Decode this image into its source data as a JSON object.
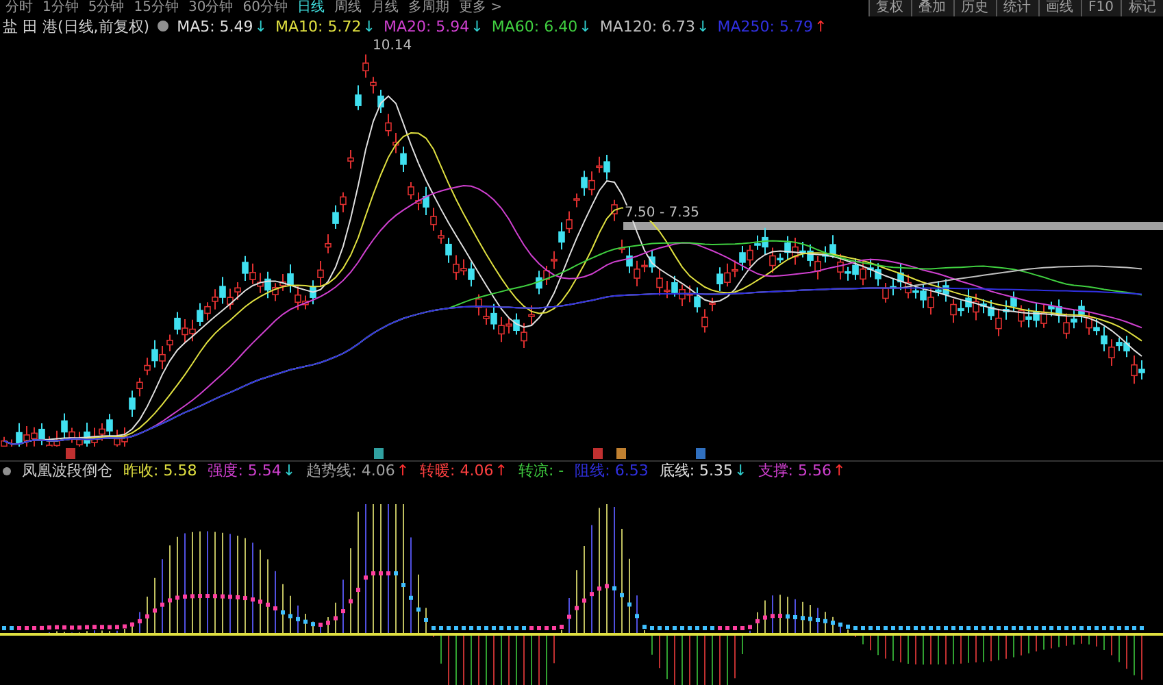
{
  "toolbar": {
    "periods": [
      {
        "label": "分时",
        "selected": false
      },
      {
        "label": "1分钟",
        "selected": false
      },
      {
        "label": "5分钟",
        "selected": false
      },
      {
        "label": "15分钟",
        "selected": false
      },
      {
        "label": "30分钟",
        "selected": false
      },
      {
        "label": "60分钟",
        "selected": false
      },
      {
        "label": "日线",
        "selected": true
      },
      {
        "label": "周线",
        "selected": false
      },
      {
        "label": "月线",
        "selected": false
      },
      {
        "label": "多周期",
        "selected": false
      },
      {
        "label": "更多 >",
        "selected": false
      }
    ],
    "buttons": [
      "复权",
      "叠加",
      "历史",
      "统计",
      "画线",
      "F10",
      "标记"
    ]
  },
  "price_panel": {
    "title": "盐 田 港(日线,前复权)",
    "averages": [
      {
        "label": "MA5: 5.49",
        "arrow": "↓",
        "rising": false,
        "color": "#e0e0e0"
      },
      {
        "label": "MA10: 5.72",
        "arrow": "↓",
        "rising": false,
        "color": "#e0e040"
      },
      {
        "label": "MA20: 5.94",
        "arrow": "↓",
        "rising": false,
        "color": "#d040d0"
      },
      {
        "label": "MA60: 6.40",
        "arrow": "↓",
        "rising": false,
        "color": "#40d040"
      },
      {
        "label": "MA120: 6.73",
        "arrow": "↓",
        "rising": false,
        "color": "#c0c0c0"
      },
      {
        "label": "MA250: 5.79",
        "arrow": "↑",
        "rising": true,
        "color": "#3030e0"
      }
    ],
    "high_label": "10.14",
    "range_label": "7.50 - 7.35"
  },
  "indicator_panel": {
    "title": "凤凰波段倒仓",
    "readings": [
      {
        "label": "昨收: 5.58",
        "color": "#e0e040"
      },
      {
        "label": "强度: 5.54",
        "arrow": "↓",
        "rising": false,
        "color": "#d040d0"
      },
      {
        "label": "趋势线: 4.06",
        "arrow": "↑",
        "rising": true,
        "color": "#a0a0a0"
      },
      {
        "label": "转暖: 4.06",
        "arrow": "↑",
        "rising": true,
        "color": "#ff4040"
      },
      {
        "label": "转凉: -",
        "color": "#40d040"
      },
      {
        "label": "阻线: 6.53",
        "color": "#3030e0"
      },
      {
        "label": "底线: 5.35",
        "arrow": "↓",
        "rising": false,
        "color": "#e0e0e0"
      },
      {
        "label": "支撑: 5.56",
        "arrow": "↑",
        "rising": true,
        "color": "#d040d0"
      }
    ]
  }
}
